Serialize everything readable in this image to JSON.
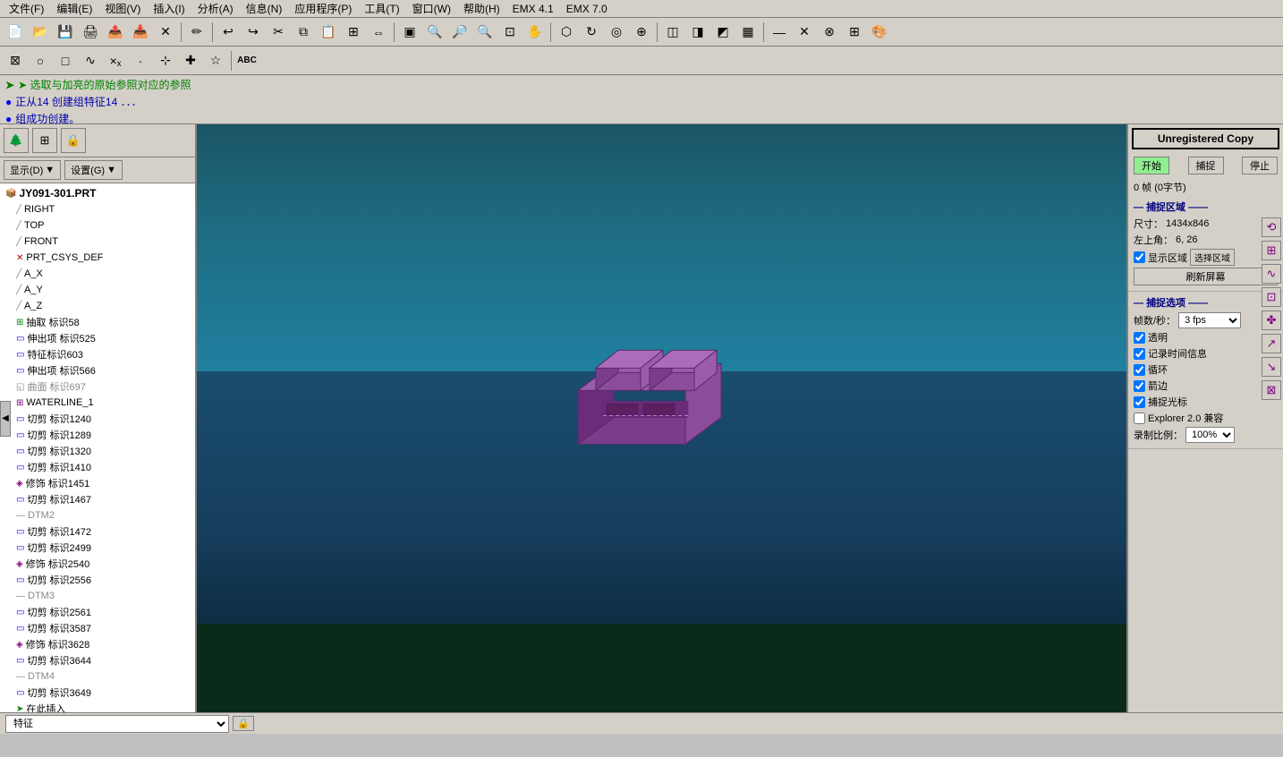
{
  "menubar": {
    "items": [
      "文件(F)",
      "编辑(E)",
      "视图(V)",
      "插入(I)",
      "分析(A)",
      "信息(N)",
      "应用程序(P)",
      "工具(T)",
      "窗口(W)",
      "帮助(H)",
      "EMX 4.1",
      "EMX 7.0"
    ]
  },
  "right_panel": {
    "unregistered": "Unregistered Copy",
    "buttons": {
      "start": "开始",
      "capture": "捕捉",
      "stop": "停止"
    },
    "counter": "0 帧 (0字节)",
    "capture_area": {
      "title": "捕捉区域",
      "size_label": "尺寸：",
      "size_value": "1434x846",
      "corner_label": "左上角：",
      "corner_value": "6, 26",
      "show_region_label": "显示区域",
      "select_region_label": "选择区域",
      "refresh_label": "刷新屏幕"
    },
    "capture_options": {
      "title": "捕捉选项",
      "fps_label": "帧数/秒：",
      "fps_value": "3 fps",
      "transparent_label": "透明",
      "record_time_label": "记录时间信息",
      "loop_label": "循环",
      "border_label": "箭边",
      "cursor_label": "捕捉光标",
      "explorer_label": "Explorer 2.0 兼容",
      "scale_label": "录制比例：",
      "scale_value": "100%"
    }
  },
  "status_messages": [
    "➤ 选取与加亮的原始参照对应的参照",
    "● 正从14 创建组特征14 ．．．",
    "● 组成功创建。"
  ],
  "tree": {
    "root": "JY091-301.PRT",
    "items": [
      {
        "label": "RIGHT",
        "icon": "plane",
        "indent": 1
      },
      {
        "label": "TOP",
        "icon": "plane",
        "indent": 1
      },
      {
        "label": "FRONT",
        "icon": "plane",
        "indent": 1
      },
      {
        "label": "PRT_CSYS_DEF",
        "icon": "csys",
        "indent": 1
      },
      {
        "label": "A_X",
        "icon": "axis",
        "indent": 1
      },
      {
        "label": "A_Y",
        "icon": "axis",
        "indent": 1
      },
      {
        "label": "A_Z",
        "icon": "axis",
        "indent": 1
      },
      {
        "label": "抽取 标识58",
        "icon": "extract",
        "indent": 1
      },
      {
        "label": "伸出项 标识525",
        "icon": "extrude",
        "indent": 1
      },
      {
        "label": "特征标识603",
        "icon": "feature",
        "indent": 1
      },
      {
        "label": "伸出项 标识566",
        "icon": "extrude",
        "indent": 1
      },
      {
        "label": "曲面 标识697",
        "icon": "surface",
        "indent": 1,
        "dim": true
      },
      {
        "label": "WATERLINE_1",
        "icon": "waterline",
        "indent": 1
      },
      {
        "label": "切剪 标识1240",
        "icon": "cut",
        "indent": 1
      },
      {
        "label": "切剪 标识1289",
        "icon": "cut",
        "indent": 1
      },
      {
        "label": "切剪 标识1320",
        "icon": "cut",
        "indent": 1
      },
      {
        "label": "切剪 标识1410",
        "icon": "cut",
        "indent": 1
      },
      {
        "label": "修饰 标识1451",
        "icon": "cosmetic",
        "indent": 1
      },
      {
        "label": "切剪 标识1467",
        "icon": "cut",
        "indent": 1
      },
      {
        "label": "DTM2",
        "icon": "datum",
        "indent": 1,
        "dim": true
      },
      {
        "label": "切剪 标识1472",
        "icon": "cut",
        "indent": 1
      },
      {
        "label": "切剪 标识2499",
        "icon": "cut",
        "indent": 1
      },
      {
        "label": "修饰 标识2540",
        "icon": "cosmetic",
        "indent": 1
      },
      {
        "label": "切剪 标识2556",
        "icon": "cut",
        "indent": 1
      },
      {
        "label": "DTM3",
        "icon": "datum",
        "indent": 1,
        "dim": true
      },
      {
        "label": "切剪 标识2561",
        "icon": "cut",
        "indent": 1
      },
      {
        "label": "切剪 标识3587",
        "icon": "cut",
        "indent": 1
      },
      {
        "label": "修饰 标识3628",
        "icon": "cosmetic",
        "indent": 1
      },
      {
        "label": "切剪 标识3644",
        "icon": "cut",
        "indent": 1
      },
      {
        "label": "DTM4",
        "icon": "datum",
        "indent": 1,
        "dim": true
      },
      {
        "label": "切剪 标识3649",
        "icon": "cut",
        "indent": 1
      },
      {
        "label": "在此插入",
        "icon": "insert",
        "indent": 1
      }
    ]
  },
  "bottom_bar": {
    "feature_label": "特征",
    "lock_icon": "🔒"
  },
  "toolbar_display": "显示(D)",
  "toolbar_settings": "设置(G)"
}
